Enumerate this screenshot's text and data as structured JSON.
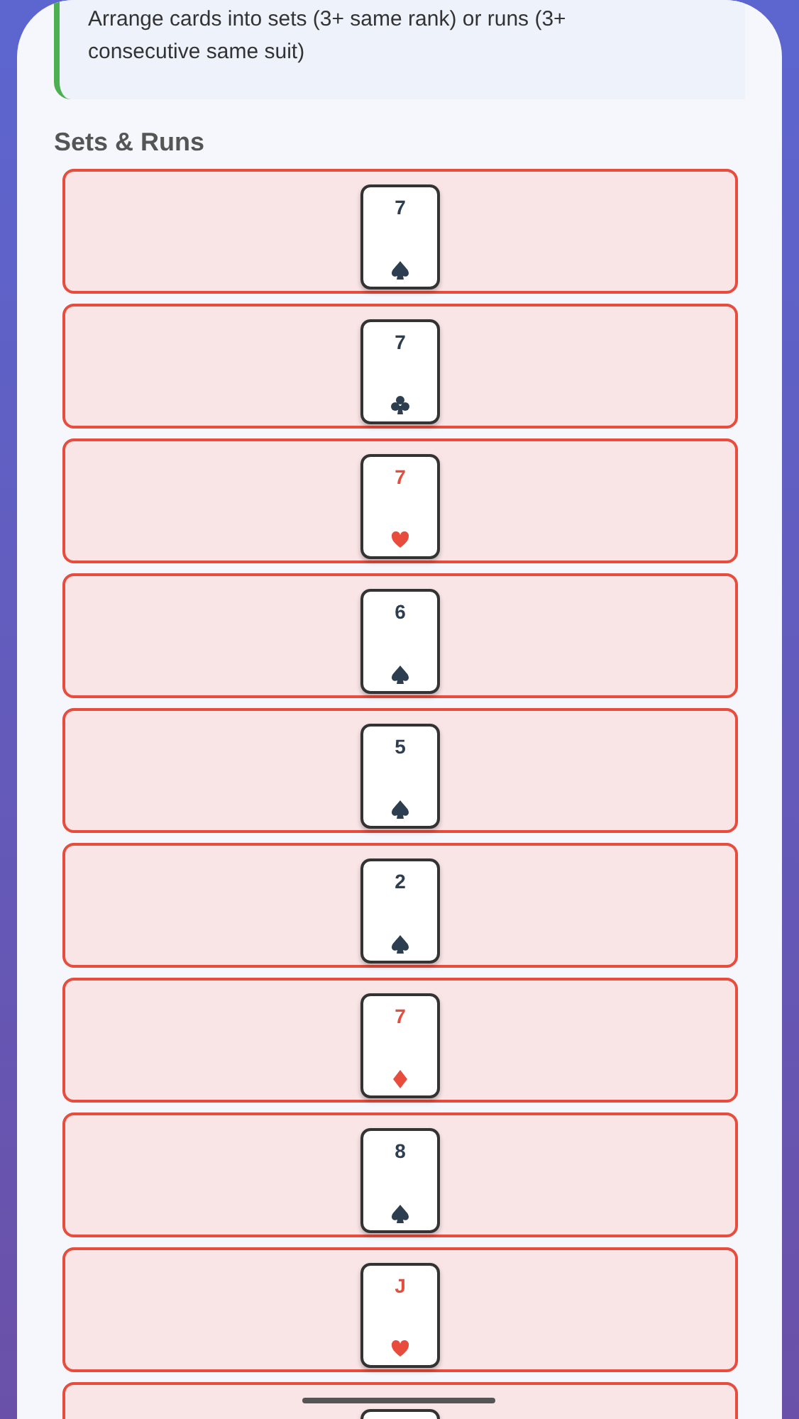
{
  "hint": {
    "text": "Arrange cards into sets (3+ same rank) or runs (3+ consecutive same suit)"
  },
  "section_title": "Sets & Runs",
  "rows": [
    {
      "kind": "spades",
      "rank": "7"
    },
    {
      "kind": "clubs",
      "rank": "7"
    },
    {
      "kind": "hearts",
      "rank": "7"
    },
    {
      "kind": "spades",
      "rank": "6"
    },
    {
      "kind": "spades",
      "rank": "5"
    },
    {
      "kind": "spades",
      "rank": "2"
    },
    {
      "kind": "diamonds",
      "rank": "7"
    },
    {
      "kind": "spades",
      "rank": "8"
    },
    {
      "kind": "hearts",
      "rank": "J"
    },
    {
      "kind": "partial"
    }
  ]
}
